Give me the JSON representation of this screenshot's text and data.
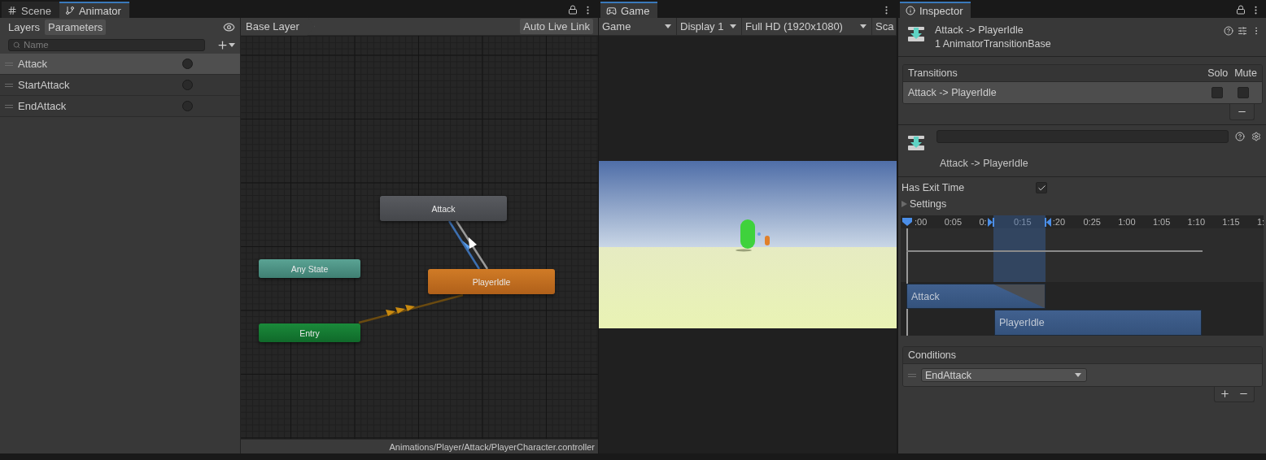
{
  "animator": {
    "tabs": [
      {
        "label": "Scene",
        "kind": "scene",
        "selected": false
      },
      {
        "label": "Animator",
        "kind": "animator",
        "selected": true
      }
    ],
    "sidebar_tabs": [
      {
        "label": "Layers",
        "selected": false
      },
      {
        "label": "Parameters",
        "selected": true
      }
    ],
    "search": {
      "placeholder": "Name"
    },
    "parameters": [
      {
        "name": "Attack",
        "selected": true
      },
      {
        "name": "StartAttack",
        "selected": false
      },
      {
        "name": "EndAttack",
        "selected": false
      }
    ],
    "breadcrumb": "Base Layer",
    "live_link_button": "Auto Live Link",
    "nodes": [
      {
        "label": "Attack",
        "kind": "state"
      },
      {
        "label": "Any State",
        "kind": "any"
      },
      {
        "label": "PlayerIdle",
        "kind": "default"
      },
      {
        "label": "Entry",
        "kind": "entry"
      }
    ],
    "path": "Animations/Player/Attack/PlayerCharacter.controller"
  },
  "game": {
    "tab": {
      "label": "Game",
      "selected": true
    },
    "toolbar": [
      {
        "label": "Game",
        "kind": "dropdown"
      },
      {
        "label": "Display 1",
        "kind": "dropdown"
      },
      {
        "label": "Full HD (1920x1080)",
        "kind": "dropdown"
      },
      {
        "label": "Sca",
        "kind": "cut"
      }
    ]
  },
  "inspector": {
    "tab": {
      "label": "Inspector",
      "selected": true
    },
    "title": "Attack -> PlayerIdle",
    "subtitle": "1 AnimatorTransitionBase",
    "transitions": {
      "heading": "Transitions",
      "solo_label": "Solo",
      "mute_label": "Mute",
      "rows": [
        {
          "label": "Attack -> PlayerIdle",
          "solo": false,
          "mute": false,
          "selected": true
        }
      ]
    },
    "transition_title": "Attack -> PlayerIdle",
    "has_exit_time": {
      "label": "Has Exit Time",
      "checked": true
    },
    "settings": {
      "label": "Settings",
      "expanded": false
    },
    "timeline": {
      "ruler_labels": [
        ":00",
        "0:05",
        "0:",
        "0:15",
        ":20",
        "0:25",
        "1:00",
        "1:05",
        "1:10",
        "1:15",
        "1:"
      ],
      "clips": [
        {
          "label": "Attack"
        },
        {
          "label": "PlayerIdle"
        }
      ]
    },
    "conditions": {
      "heading": "Conditions",
      "items": [
        {
          "parameter": "EndAttack"
        }
      ]
    }
  }
}
